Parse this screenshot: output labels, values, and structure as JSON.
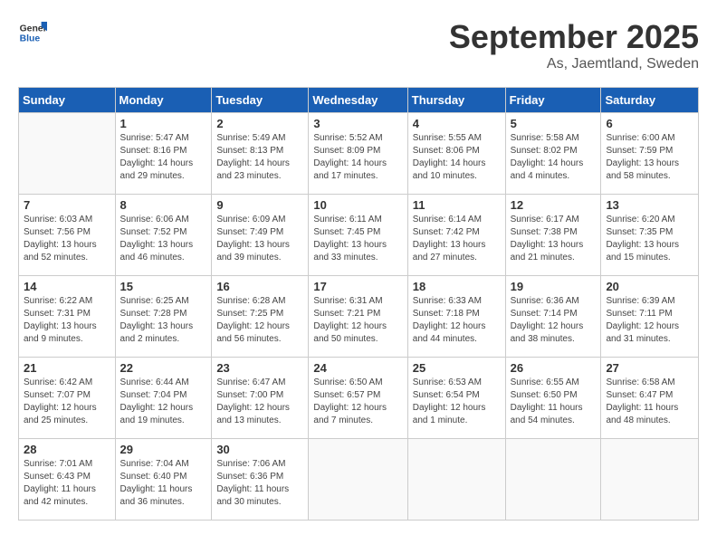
{
  "header": {
    "logo": {
      "general": "General",
      "blue": "Blue"
    },
    "month": "September 2025",
    "location": "As, Jaemtland, Sweden"
  },
  "weekdays": [
    "Sunday",
    "Monday",
    "Tuesday",
    "Wednesday",
    "Thursday",
    "Friday",
    "Saturday"
  ],
  "weeks": [
    [
      {
        "day": "",
        "info": ""
      },
      {
        "day": "1",
        "info": "Sunrise: 5:47 AM\nSunset: 8:16 PM\nDaylight: 14 hours\nand 29 minutes."
      },
      {
        "day": "2",
        "info": "Sunrise: 5:49 AM\nSunset: 8:13 PM\nDaylight: 14 hours\nand 23 minutes."
      },
      {
        "day": "3",
        "info": "Sunrise: 5:52 AM\nSunset: 8:09 PM\nDaylight: 14 hours\nand 17 minutes."
      },
      {
        "day": "4",
        "info": "Sunrise: 5:55 AM\nSunset: 8:06 PM\nDaylight: 14 hours\nand 10 minutes."
      },
      {
        "day": "5",
        "info": "Sunrise: 5:58 AM\nSunset: 8:02 PM\nDaylight: 14 hours\nand 4 minutes."
      },
      {
        "day": "6",
        "info": "Sunrise: 6:00 AM\nSunset: 7:59 PM\nDaylight: 13 hours\nand 58 minutes."
      }
    ],
    [
      {
        "day": "7",
        "info": "Sunrise: 6:03 AM\nSunset: 7:56 PM\nDaylight: 13 hours\nand 52 minutes."
      },
      {
        "day": "8",
        "info": "Sunrise: 6:06 AM\nSunset: 7:52 PM\nDaylight: 13 hours\nand 46 minutes."
      },
      {
        "day": "9",
        "info": "Sunrise: 6:09 AM\nSunset: 7:49 PM\nDaylight: 13 hours\nand 39 minutes."
      },
      {
        "day": "10",
        "info": "Sunrise: 6:11 AM\nSunset: 7:45 PM\nDaylight: 13 hours\nand 33 minutes."
      },
      {
        "day": "11",
        "info": "Sunrise: 6:14 AM\nSunset: 7:42 PM\nDaylight: 13 hours\nand 27 minutes."
      },
      {
        "day": "12",
        "info": "Sunrise: 6:17 AM\nSunset: 7:38 PM\nDaylight: 13 hours\nand 21 minutes."
      },
      {
        "day": "13",
        "info": "Sunrise: 6:20 AM\nSunset: 7:35 PM\nDaylight: 13 hours\nand 15 minutes."
      }
    ],
    [
      {
        "day": "14",
        "info": "Sunrise: 6:22 AM\nSunset: 7:31 PM\nDaylight: 13 hours\nand 9 minutes."
      },
      {
        "day": "15",
        "info": "Sunrise: 6:25 AM\nSunset: 7:28 PM\nDaylight: 13 hours\nand 2 minutes."
      },
      {
        "day": "16",
        "info": "Sunrise: 6:28 AM\nSunset: 7:25 PM\nDaylight: 12 hours\nand 56 minutes."
      },
      {
        "day": "17",
        "info": "Sunrise: 6:31 AM\nSunset: 7:21 PM\nDaylight: 12 hours\nand 50 minutes."
      },
      {
        "day": "18",
        "info": "Sunrise: 6:33 AM\nSunset: 7:18 PM\nDaylight: 12 hours\nand 44 minutes."
      },
      {
        "day": "19",
        "info": "Sunrise: 6:36 AM\nSunset: 7:14 PM\nDaylight: 12 hours\nand 38 minutes."
      },
      {
        "day": "20",
        "info": "Sunrise: 6:39 AM\nSunset: 7:11 PM\nDaylight: 12 hours\nand 31 minutes."
      }
    ],
    [
      {
        "day": "21",
        "info": "Sunrise: 6:42 AM\nSunset: 7:07 PM\nDaylight: 12 hours\nand 25 minutes."
      },
      {
        "day": "22",
        "info": "Sunrise: 6:44 AM\nSunset: 7:04 PM\nDaylight: 12 hours\nand 19 minutes."
      },
      {
        "day": "23",
        "info": "Sunrise: 6:47 AM\nSunset: 7:00 PM\nDaylight: 12 hours\nand 13 minutes."
      },
      {
        "day": "24",
        "info": "Sunrise: 6:50 AM\nSunset: 6:57 PM\nDaylight: 12 hours\nand 7 minutes."
      },
      {
        "day": "25",
        "info": "Sunrise: 6:53 AM\nSunset: 6:54 PM\nDaylight: 12 hours\nand 1 minute."
      },
      {
        "day": "26",
        "info": "Sunrise: 6:55 AM\nSunset: 6:50 PM\nDaylight: 11 hours\nand 54 minutes."
      },
      {
        "day": "27",
        "info": "Sunrise: 6:58 AM\nSunset: 6:47 PM\nDaylight: 11 hours\nand 48 minutes."
      }
    ],
    [
      {
        "day": "28",
        "info": "Sunrise: 7:01 AM\nSunset: 6:43 PM\nDaylight: 11 hours\nand 42 minutes."
      },
      {
        "day": "29",
        "info": "Sunrise: 7:04 AM\nSunset: 6:40 PM\nDaylight: 11 hours\nand 36 minutes."
      },
      {
        "day": "30",
        "info": "Sunrise: 7:06 AM\nSunset: 6:36 PM\nDaylight: 11 hours\nand 30 minutes."
      },
      {
        "day": "",
        "info": ""
      },
      {
        "day": "",
        "info": ""
      },
      {
        "day": "",
        "info": ""
      },
      {
        "day": "",
        "info": ""
      }
    ]
  ]
}
